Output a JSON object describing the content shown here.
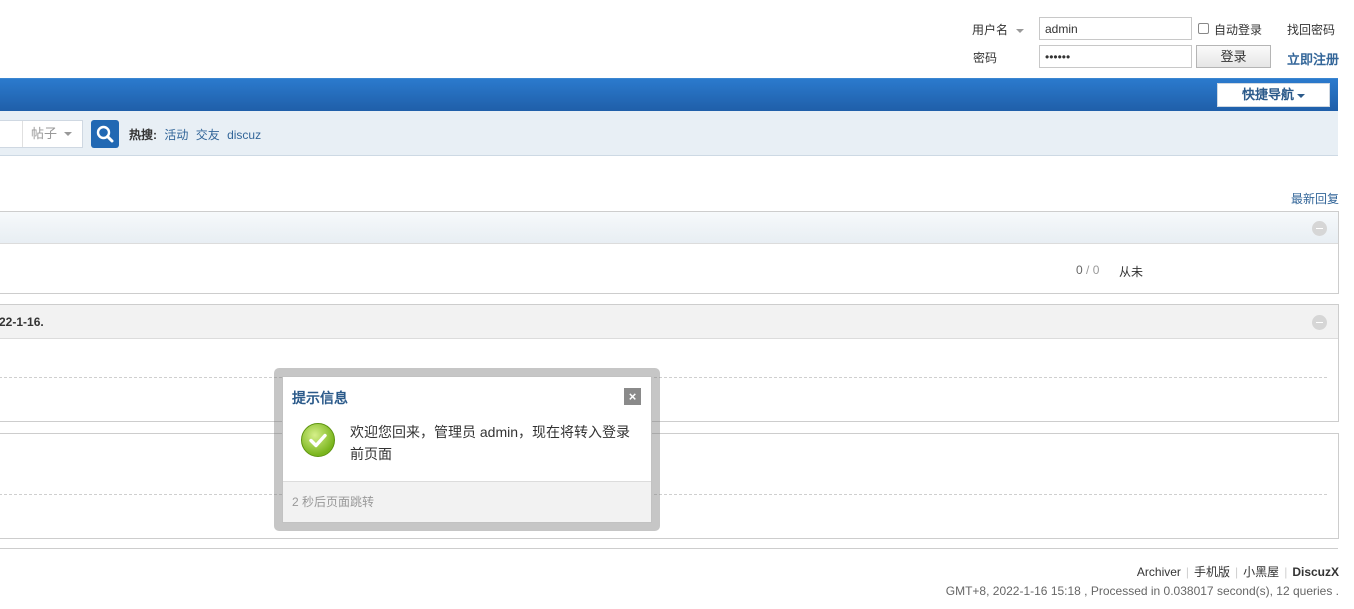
{
  "login": {
    "username_label": "用户名",
    "username_value": "admin",
    "password_label": "密码",
    "password_value": "••••••",
    "auto_login_label": "自动登录",
    "login_button": "登录",
    "forgot_password": "找回密码",
    "register": "立即注册"
  },
  "nav": {
    "quick_nav": "快捷导航"
  },
  "search": {
    "type_selected": "帖子",
    "hot_label": "热搜:",
    "hot_items": [
      "活动",
      "交友",
      "discuz"
    ]
  },
  "main": {
    "latest_reply": "最新回复",
    "forum_stats": "0",
    "forum_stats_sep": "/",
    "forum_stats2": "0",
    "forum_last": "从未",
    "section2_title": "22-1-16."
  },
  "dialog": {
    "title": "提示信息",
    "close": "×",
    "message": "欢迎您回来，管理员 admin，现在将转入登录前页面",
    "footer": "2 秒后页面跳转"
  },
  "footer": {
    "links": [
      "Archiver",
      "手机版",
      "小黑屋",
      "DiscuzX"
    ],
    "info": "GMT+8, 2022-1-16 15:18 , Processed in 0.038017 second(s), 12 queries ."
  },
  "colors": {
    "nav_blue": "#2168b3",
    "link": "#336699",
    "success_green": "#7ab51d"
  }
}
